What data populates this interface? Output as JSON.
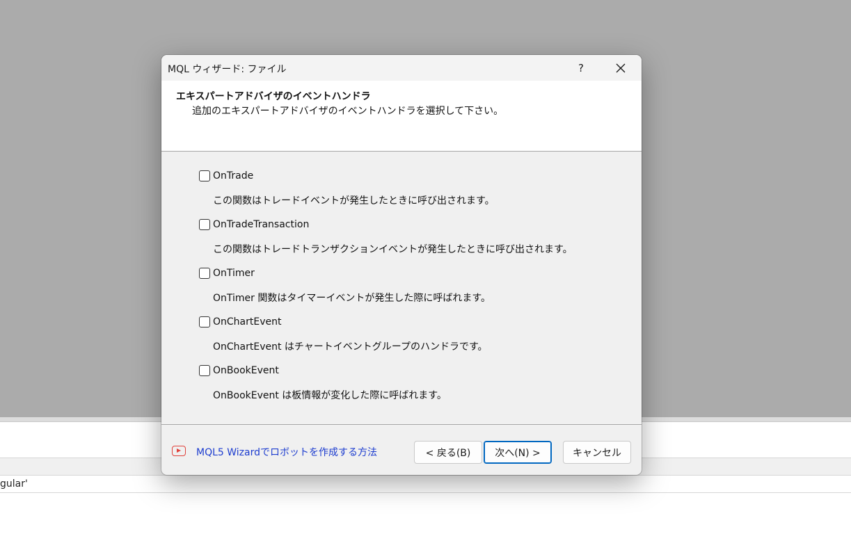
{
  "background": {
    "row_text": "gular'"
  },
  "dialog": {
    "title": "MQL ウィザード: ファイル",
    "help_label": "?",
    "header": {
      "title": "エキスパートアドバイザのイベントハンドラ",
      "subtitle": "追加のエキスパートアドバイザのイベントハンドラを選択して下さい。"
    },
    "options": [
      {
        "label": "OnTrade",
        "description": "この関数はトレードイベントが発生したときに呼び出されます。",
        "checked": false
      },
      {
        "label": "OnTradeTransaction",
        "description": "この関数はトレードトランザクションイベントが発生したときに呼び出されます。",
        "checked": false
      },
      {
        "label": "OnTimer",
        "description": "OnTimer 関数はタイマーイベントが発生した際に呼ばれます。",
        "checked": false
      },
      {
        "label": "OnChartEvent",
        "description": "OnChartEvent はチャートイベントグループのハンドラです。",
        "checked": false
      },
      {
        "label": "OnBookEvent",
        "description": "OnBookEvent は板情報が変化した際に呼ばれます。",
        "checked": false
      }
    ],
    "footer": {
      "link_text": "MQL5 Wizardでロボットを作成する方法",
      "back_label": "< 戻る(B)",
      "next_label": "次へ(N) >",
      "cancel_label": "キャンセル"
    },
    "colors": {
      "link": "#1c3ccf",
      "video_icon": "#e0403a",
      "default_button_border": "#0067c0"
    }
  }
}
